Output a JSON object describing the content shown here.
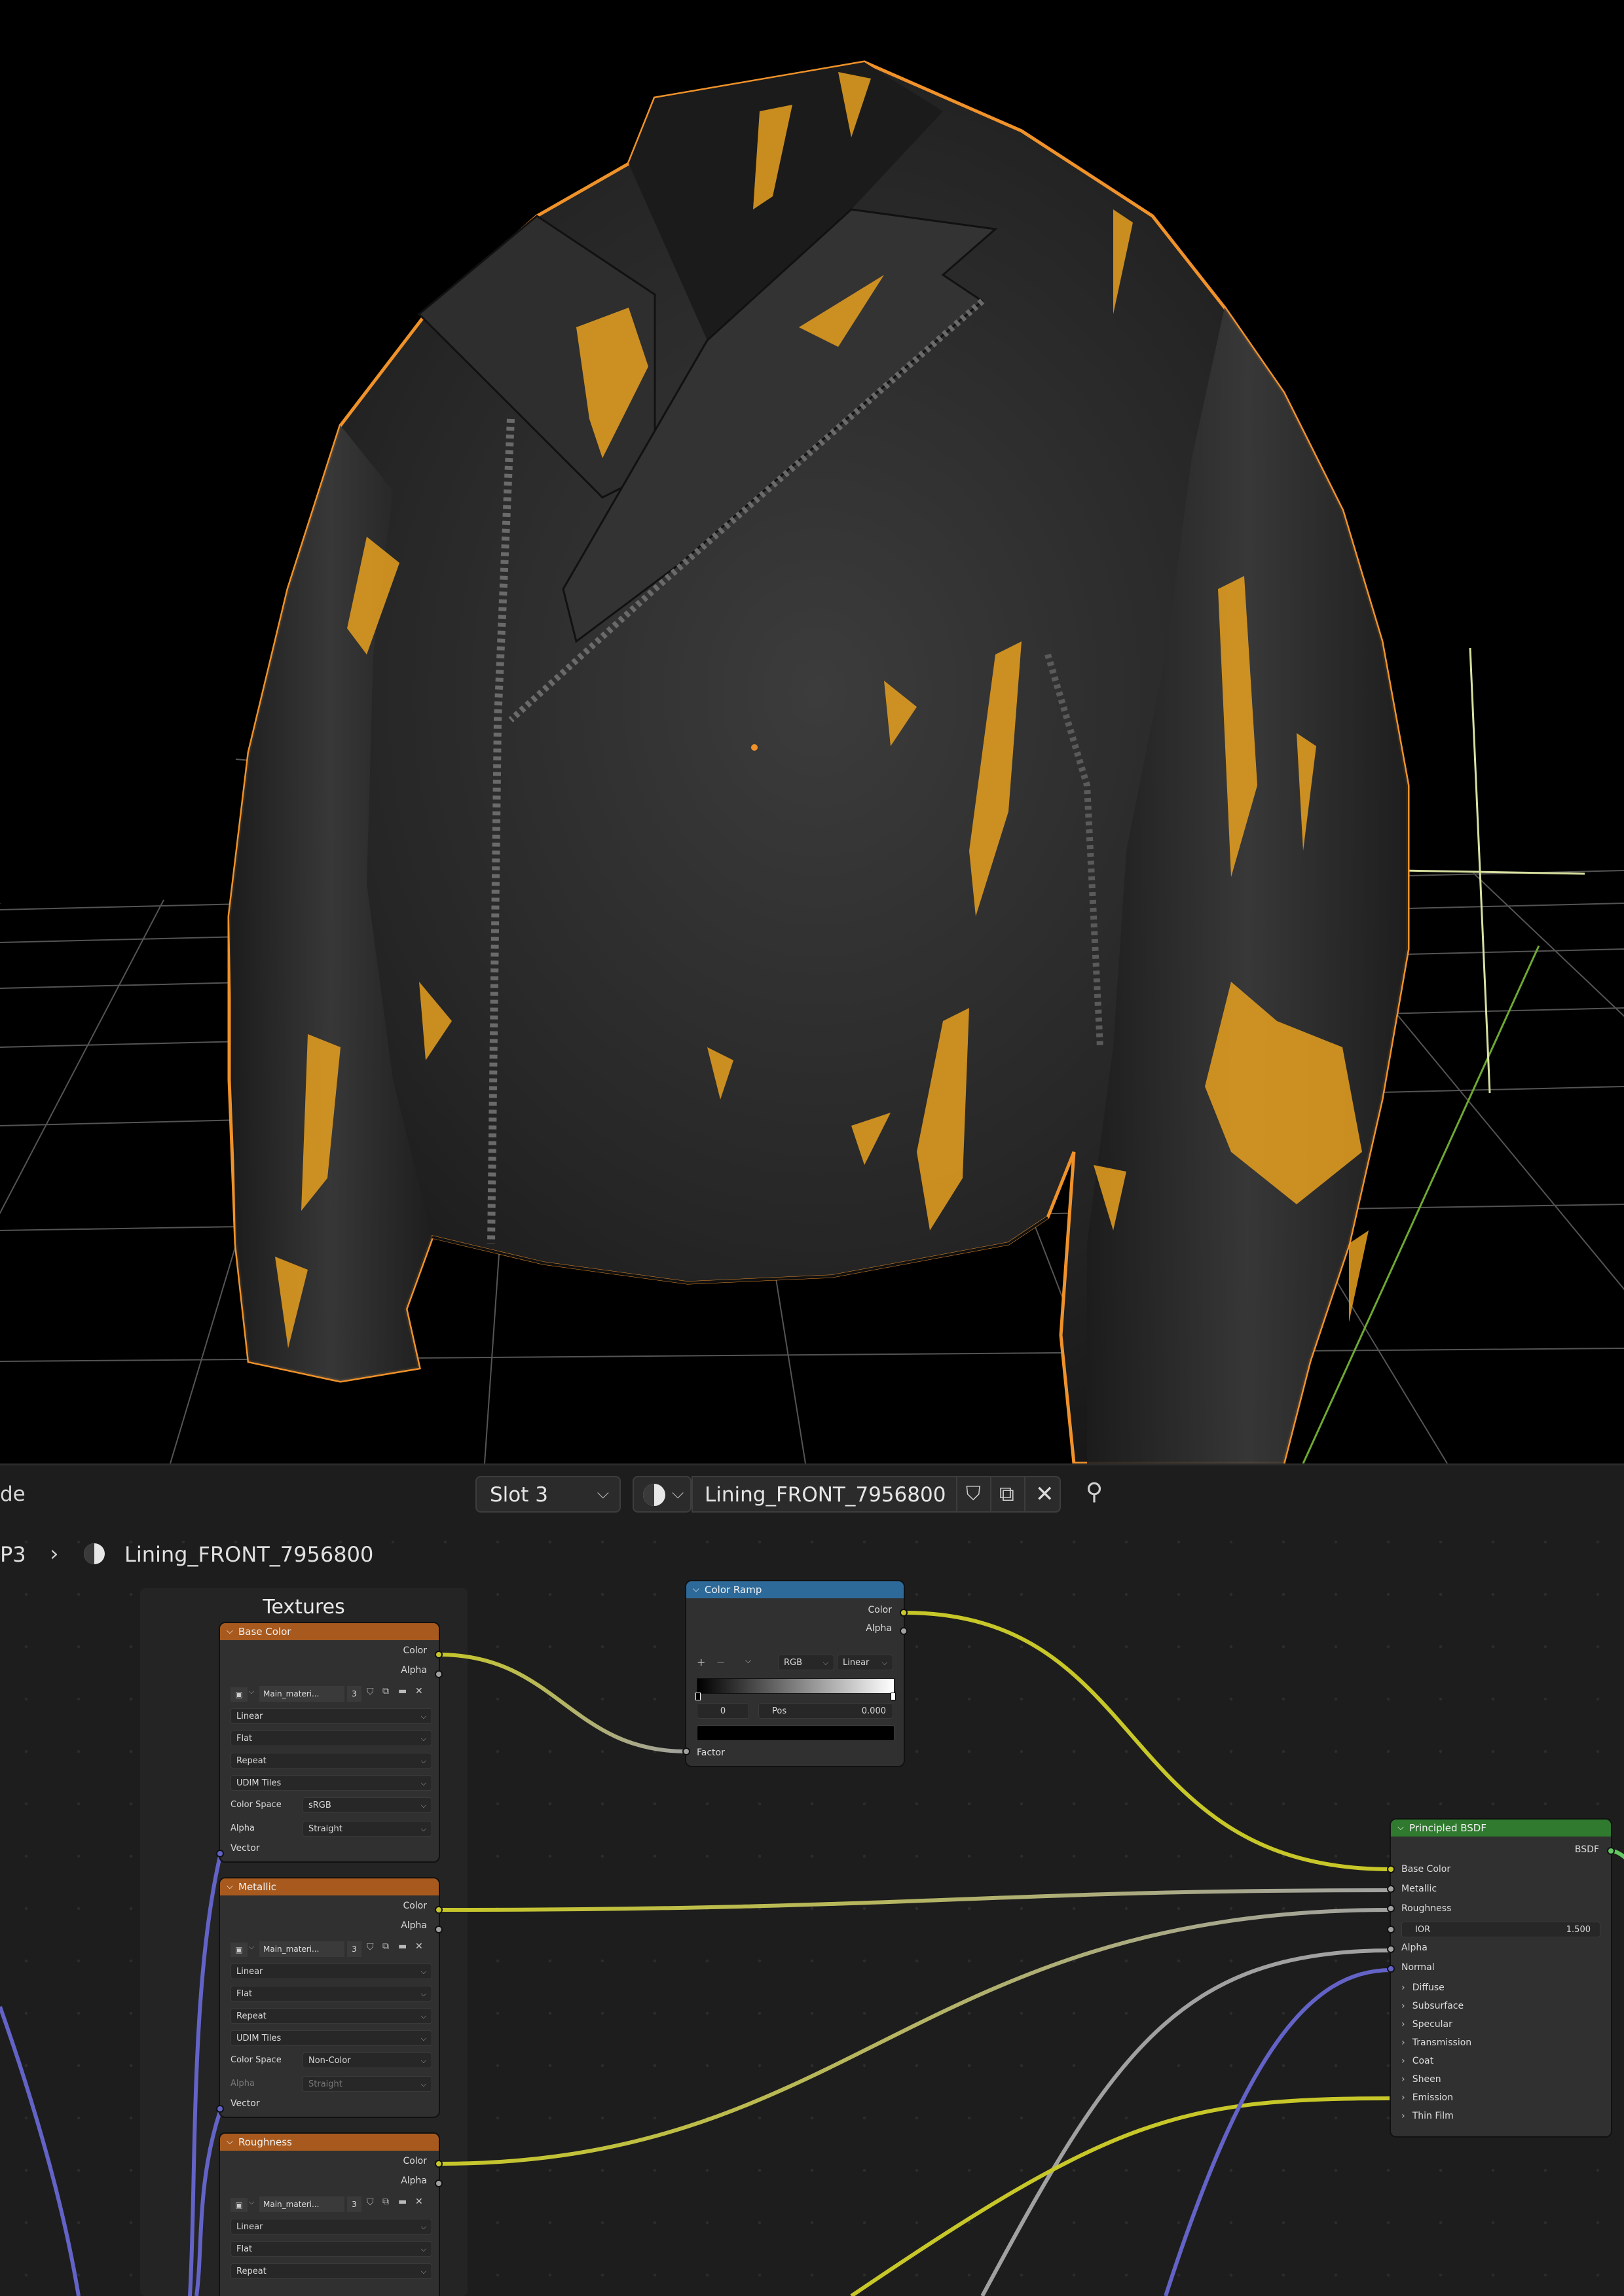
{
  "header": {
    "mode_label": "de",
    "slot_select": "Slot 3",
    "material_name": "Lining_FRONT_7956800",
    "breadcrumb_prefix": "P3",
    "breadcrumb_material": "Lining_FRONT_7956800"
  },
  "frame": {
    "label": "Textures"
  },
  "nodes": {
    "base_color": {
      "title": "Base Color",
      "outputs": [
        "Color",
        "Alpha"
      ],
      "image_name": "Main_materi...",
      "users": "3",
      "interpolation": "Linear",
      "projection": "Flat",
      "extension": "Repeat",
      "source": "UDIM Tiles",
      "color_space_label": "Color Space",
      "color_space": "sRGB",
      "alpha_label": "Alpha",
      "alpha_mode": "Straight",
      "input": "Vector"
    },
    "metallic": {
      "title": "Metallic",
      "outputs": [
        "Color",
        "Alpha"
      ],
      "image_name": "Main_materi...",
      "users": "3",
      "interpolation": "Linear",
      "projection": "Flat",
      "extension": "Repeat",
      "source": "UDIM Tiles",
      "color_space_label": "Color Space",
      "color_space": "Non-Color",
      "alpha_label": "Alpha",
      "alpha_mode": "Straight",
      "input": "Vector"
    },
    "roughness": {
      "title": "Roughness",
      "outputs": [
        "Color",
        "Alpha"
      ],
      "image_name": "Main_materi...",
      "users": "3",
      "interpolation": "Linear",
      "projection": "Flat",
      "extension": "Repeat"
    },
    "color_ramp": {
      "title": "Color Ramp",
      "outputs": [
        "Color",
        "Alpha"
      ],
      "color_mode": "RGB",
      "interpolation": "Linear",
      "stop_index": "0",
      "pos_label": "Pos",
      "pos_value": "0.000",
      "input": "Factor"
    },
    "principled": {
      "title": "Principled BSDF",
      "output": "BSDF",
      "inputs": [
        "Base Color",
        "Metallic",
        "Roughness"
      ],
      "ior_label": "IOR",
      "ior_value": "1.500",
      "inputs2": [
        "Alpha",
        "Normal"
      ],
      "panels": [
        "Diffuse",
        "Subsurface",
        "Specular",
        "Transmission",
        "Coat",
        "Sheen",
        "Emission",
        "Thin Film"
      ]
    }
  },
  "colors": {
    "selection_outline": "#f0922a",
    "leather": "#2a2a2a",
    "paint": "#e8a020",
    "texture_header": "#a85a1e",
    "converter_header": "#2d6a9a",
    "shader_header": "#2f7a2f",
    "socket_color": "#c7c729",
    "socket_float": "#a1a1a1",
    "socket_vector": "#6363c7",
    "socket_shader": "#63c763"
  }
}
